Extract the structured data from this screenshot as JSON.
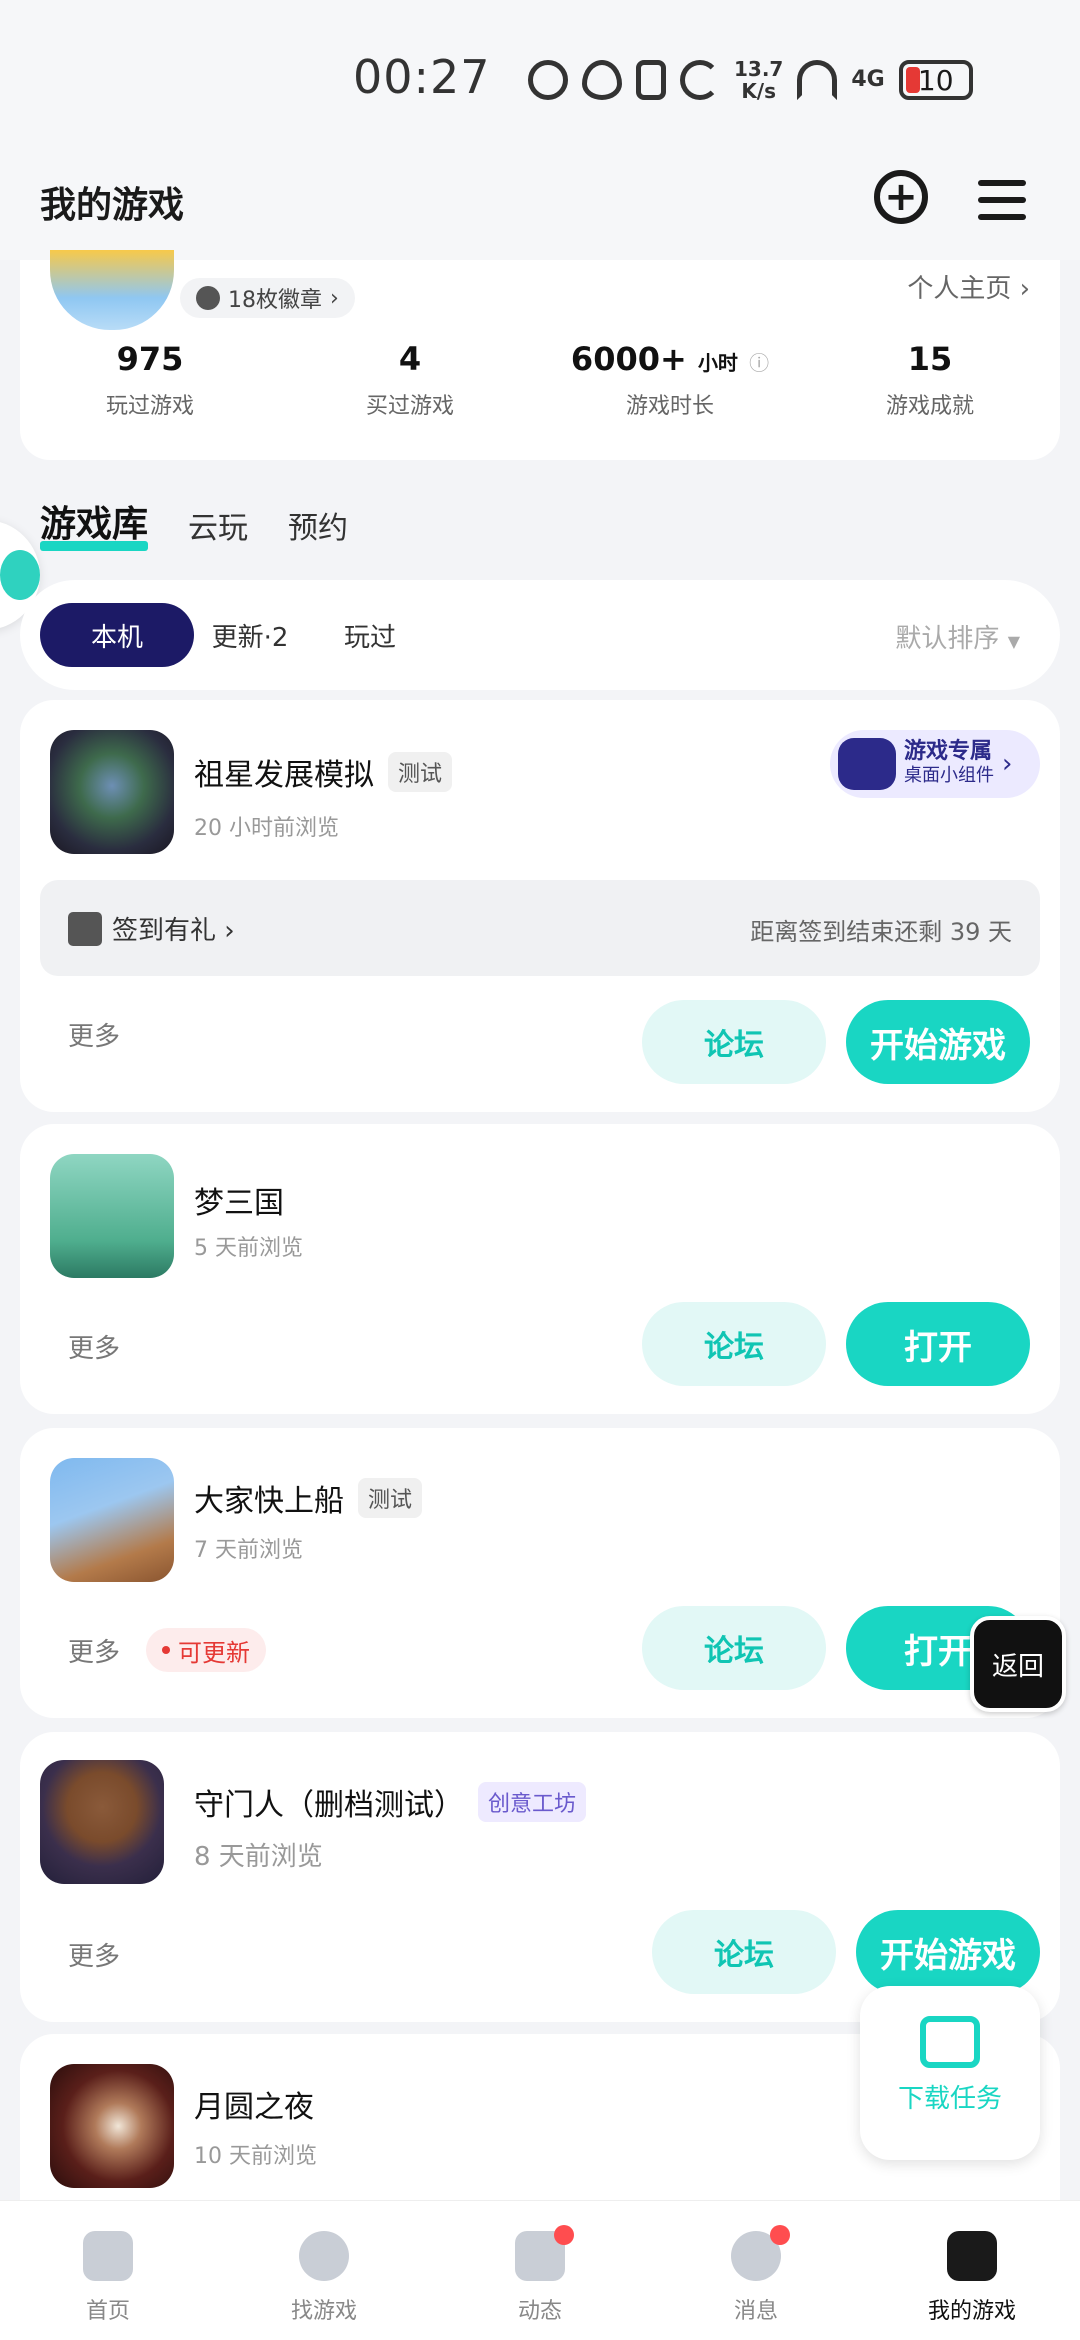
{
  "status_bar": {
    "time": "00:27",
    "net_speed_value": "13.7",
    "net_speed_unit": "K/s",
    "network": "4G",
    "battery": "10"
  },
  "header": {
    "title": "我的游戏"
  },
  "profile": {
    "badges": "18枚徽章",
    "homepage_link": "个人主页",
    "stats": [
      {
        "value": "975",
        "unit": "",
        "label": "玩过游戏"
      },
      {
        "value": "4",
        "unit": "",
        "label": "买过游戏"
      },
      {
        "value": "6000+",
        "unit": "小时",
        "label": "游戏时长"
      },
      {
        "value": "15",
        "unit": "",
        "label": "游戏成就"
      }
    ]
  },
  "main_tabs": [
    "游戏库",
    "云玩",
    "预约"
  ],
  "filters": {
    "chips": [
      "本机",
      "更新·2",
      "玩过"
    ],
    "sort": "默认排序"
  },
  "games": [
    {
      "name": "祖星发展模拟",
      "tag": "测试",
      "browse": "20 小时前浏览",
      "widget": {
        "title": "游戏专属",
        "subtitle": "桌面小组件"
      },
      "checkin": {
        "label": "签到有礼",
        "remain": "距离签到结束还剩 39 天"
      },
      "more": "更多",
      "forum": "论坛",
      "action": "开始游戏"
    },
    {
      "name": "梦三国",
      "tag": "",
      "browse": "5 天前浏览",
      "more": "更多",
      "forum": "论坛",
      "action": "打开"
    },
    {
      "name": "大家快上船",
      "tag": "测试",
      "browse": "7 天前浏览",
      "more": "更多",
      "update": "可更新",
      "forum": "论坛",
      "action": "打开"
    },
    {
      "name": "守门人（删档测试）",
      "tag": "创意工坊",
      "browse": "8 天前浏览",
      "more": "更多",
      "forum": "论坛",
      "action": "开始游戏"
    },
    {
      "name": "月圆之夜",
      "tag": "",
      "browse": "10 天前浏览"
    }
  ],
  "floating": {
    "return": "返回",
    "download": "下载任务"
  },
  "bottom_nav": [
    {
      "label": "首页",
      "icon": "home-icon"
    },
    {
      "label": "找游戏",
      "icon": "planet-icon"
    },
    {
      "label": "动态",
      "icon": "feed-icon"
    },
    {
      "label": "消息",
      "icon": "message-icon"
    },
    {
      "label": "我的游戏",
      "icon": "gamepad-icon"
    }
  ]
}
